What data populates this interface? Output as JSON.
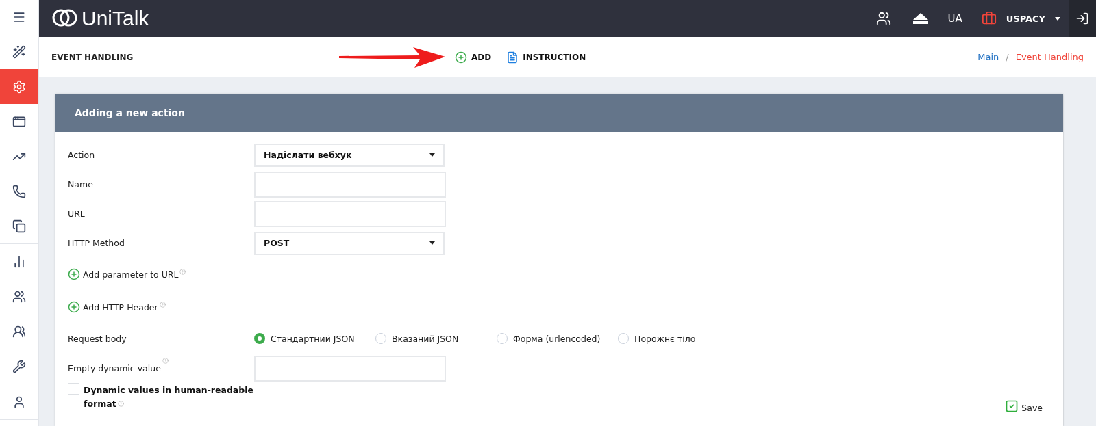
{
  "sidebar": {
    "groups": [
      [
        {
          "selected": false
        },
        {
          "selected": true
        },
        {
          "selected": false
        },
        {
          "selected": false
        },
        {
          "selected": false
        },
        {
          "selected": false
        }
      ],
      [
        {
          "selected": false
        },
        {
          "selected": false
        },
        {
          "selected": false
        },
        {
          "selected": false
        }
      ],
      [
        {
          "selected": false
        }
      ]
    ]
  },
  "topbar": {
    "logo": "UniTalk",
    "language": "UA",
    "account": "USPACY"
  },
  "header": {
    "title": "EVENT HANDLING",
    "actions": [
      {
        "kind": "add",
        "label": "ADD"
      },
      {
        "kind": "doc",
        "label": "INSTRUCTION"
      }
    ],
    "breadcrumb_separator": "/",
    "breadcrumbs": [
      {
        "label": "Main",
        "current": false
      },
      {
        "label": "Event Handling",
        "current": true
      }
    ]
  },
  "card": {
    "title": "Adding a new action",
    "fields": [
      {
        "kind": "select",
        "label": "Action",
        "value": "Надіслати вебхук"
      },
      {
        "kind": "input",
        "label": "Name"
      },
      {
        "kind": "input",
        "label": "URL"
      },
      {
        "kind": "select",
        "label": "HTTP Method",
        "value": "POST"
      },
      {
        "kind": "add",
        "label": "Add parameter to URL",
        "help": true
      },
      {
        "kind": "add",
        "label": "Add HTTP Header",
        "help": true
      },
      {
        "kind": "radio",
        "label": "Request body",
        "options": [
          {
            "label": "Стандартний JSON",
            "selected": true
          },
          {
            "label": "Вказаний JSON",
            "selected": false
          },
          {
            "label": "Форма (urlencoded)",
            "selected": false
          },
          {
            "label": "Порожнє тіло",
            "selected": false
          }
        ]
      },
      {
        "kind": "input",
        "label": "Empty dynamic value",
        "help": true
      },
      {
        "kind": "checkbox",
        "label": "Dynamic values in human-readable",
        "label_2": "format",
        "checked": false,
        "help": true
      }
    ],
    "save": "Save"
  }
}
